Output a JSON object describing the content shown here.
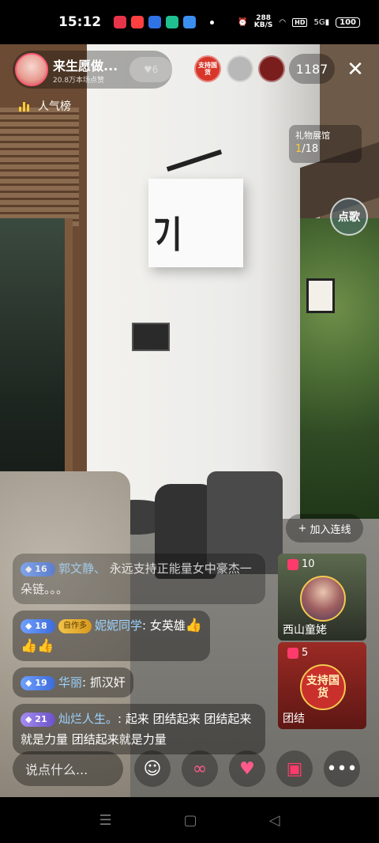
{
  "status_bar": {
    "time": "15:12",
    "net_speed": "288",
    "net_unit": "KB/S",
    "hd": "HD",
    "signal": "5G",
    "battery": "100"
  },
  "host": {
    "name": "来生愿做...",
    "subtitle": "20.8万本场点赞",
    "follow_count": "6"
  },
  "viewers": {
    "avatar1_text": "支持国货",
    "count": "1187"
  },
  "rank": {
    "label": "人气榜"
  },
  "gift_gallery": {
    "title": "礼物展馆",
    "current": "1",
    "total": "/18"
  },
  "song_button": "点歌",
  "connect_button": "加入连线",
  "comments": [
    {
      "level": "16",
      "name": "郭文静、",
      "text": "永远支持正能量女中豪杰一朵链。。。"
    },
    {
      "level": "18",
      "fan_tag": "自作多",
      "name": "妮妮同学",
      "text": "女英雄"
    },
    {
      "level": "19",
      "name": "华丽",
      "text": "抓汉奸"
    },
    {
      "level": "21",
      "name": "灿烂人生。",
      "text": "起来 团结起来 团结起来就是力量 团结起来就是力量"
    }
  ],
  "gift_cards": [
    {
      "count": "10",
      "label": "西山童姥"
    },
    {
      "count": "5",
      "label": "团结",
      "image_text": "支持国货"
    }
  ],
  "chat_placeholder": "说点什么...",
  "colors": {
    "accent": "#ff3b6b",
    "level_blue": "#3d6bd9",
    "gold": "#ffcc33"
  }
}
